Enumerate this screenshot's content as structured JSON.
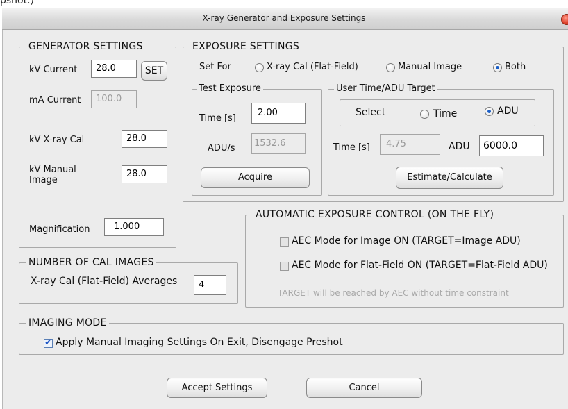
{
  "top_fragment": "pshot.)",
  "window": {
    "title": "X-ray Generator and Exposure Settings"
  },
  "generator": {
    "legend": "GENERATOR SETTINGS",
    "kv_current_label": "kV Current",
    "kv_current_value": "28.0",
    "set_label": "SET",
    "ma_current_label": "mA Current",
    "ma_current_value": "100.0",
    "kv_xray_cal_label": "kV X-ray Cal",
    "kv_xray_cal_value": "28.0",
    "kv_manual_label_1": "kV Manual",
    "kv_manual_label_2": "Image",
    "kv_manual_value": "28.0",
    "magnification_label": "Magnification",
    "magnification_value": "1.000"
  },
  "exposure": {
    "legend": "EXPOSURE SETTINGS",
    "set_for_label": "Set For",
    "options": [
      {
        "label": "X-ray Cal (Flat-Field)",
        "selected": false
      },
      {
        "label": "Manual Image",
        "selected": false
      },
      {
        "label": "Both",
        "selected": true
      }
    ],
    "test": {
      "legend": "Test Exposure",
      "time_label": "Time [s]",
      "time_value": "2.00",
      "adu_label": "ADU/s",
      "adu_value": "1532.6",
      "acquire_label": "Acquire"
    },
    "target": {
      "legend": "User Time/ADU Target",
      "select_label": "Select",
      "time_option": "Time",
      "adu_option": "ADU",
      "selected": "ADU",
      "time_label": "Time [s]",
      "time_value": "4.75",
      "adu_label": "ADU",
      "adu_value": "6000.0",
      "estimate_label": "Estimate/Calculate"
    }
  },
  "aec": {
    "legend": "AUTOMATIC EXPOSURE CONTROL (ON THE FLY)",
    "image_mode_label": "AEC Mode for Image ON (TARGET=Image ADU)",
    "image_mode_checked": false,
    "flat_mode_label": "AEC Mode for Flat-Field ON (TARGET=Flat-Field ADU)",
    "flat_mode_checked": false,
    "note": "TARGET will be reached by AEC without time constraint"
  },
  "cal_images": {
    "legend": "NUMBER OF CAL IMAGES",
    "averages_label": "X-ray Cal (Flat-Field) Averages",
    "averages_value": "4"
  },
  "imaging": {
    "legend": "IMAGING MODE",
    "apply_label": "Apply Manual Imaging Settings On Exit, Disengage Preshot",
    "apply_checked": true
  },
  "footer": {
    "accept_label": "Accept Settings",
    "cancel_label": "Cancel"
  }
}
